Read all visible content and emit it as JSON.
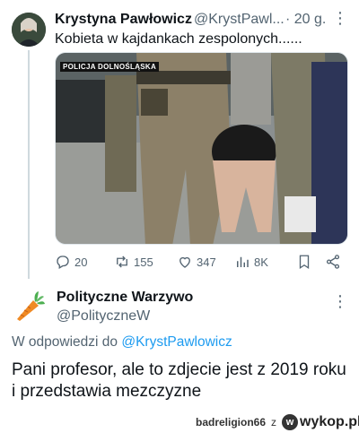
{
  "tweet": {
    "author_name": "Krystyna Pawłowicz",
    "author_handle": "@KrystPawl...",
    "time": "· 20 g.",
    "text": "Kobieta w kajdankach zespolonych......",
    "photo_tag": "POLICJA DOLNOŚLĄSKA",
    "actions": {
      "replies": "20",
      "retweets": "155",
      "likes": "347",
      "views": "8K"
    }
  },
  "reply": {
    "author_name": "Polityczne Warzywo",
    "author_handle": "@PolitycznеW",
    "reply_prefix": "W odpowiedzi do",
    "reply_target": "@KrystPawlowicz",
    "text": "Pani profesor, ale to zdjecie jest z 2019 roku i przedstawia mezczyzne"
  },
  "watermark": {
    "user": "badreligion66",
    "separator": "z",
    "site": "wykop.pl"
  },
  "colors": {
    "link": "#1d9bf0",
    "muted": "#536471"
  }
}
